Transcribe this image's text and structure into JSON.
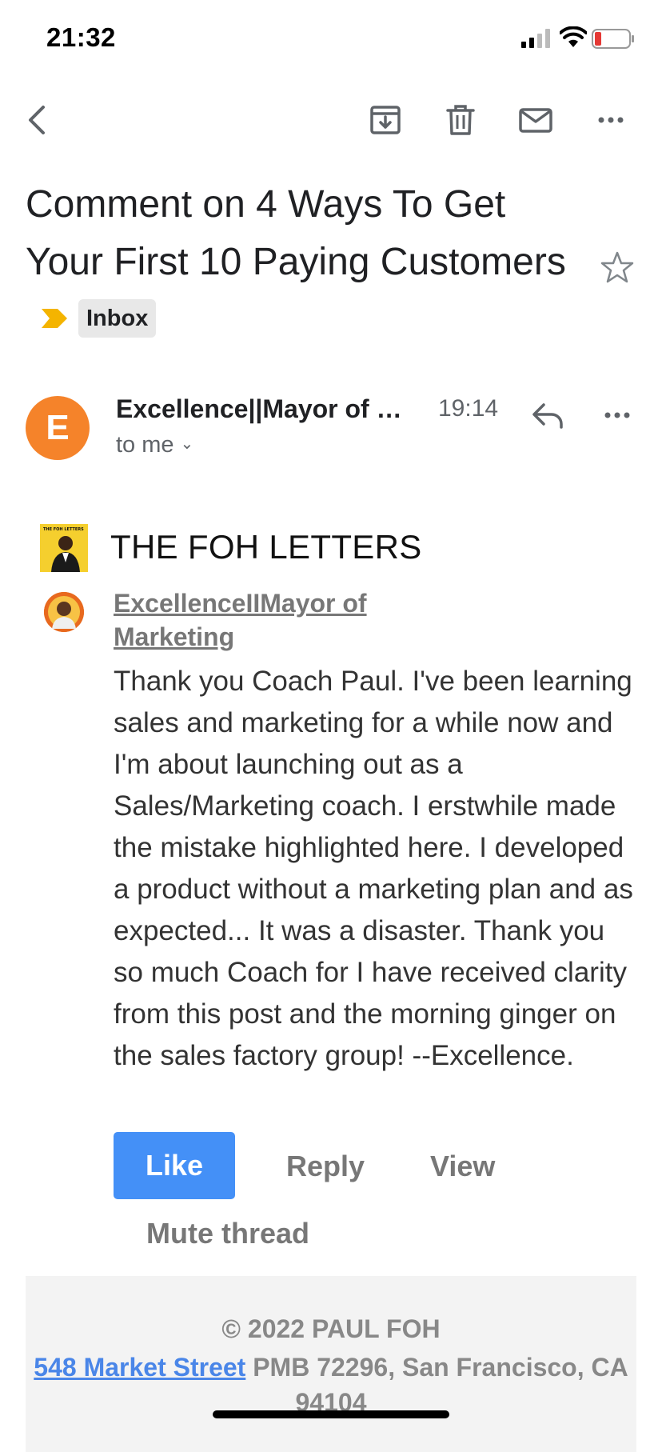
{
  "status_bar": {
    "time": "21:32"
  },
  "toolbar": {
    "back_icon": "chevron-left-icon",
    "archive_icon": "archive-icon",
    "delete_icon": "trash-icon",
    "mark_unread_icon": "mail-icon",
    "more_icon": "more-horizontal-icon"
  },
  "email": {
    "subject": "Comment on 4 Ways To Get Your First 10 Paying Customers",
    "label": "Inbox",
    "importance_color": "#f4b400",
    "sender": {
      "initial": "E",
      "name": "Excellence||Mayor of Marketing",
      "time": "19:14",
      "to": "to me",
      "avatar_color": "#f5832a"
    }
  },
  "body": {
    "brand_title": "THE FOH LETTERS",
    "brand_logo_text": "THE FOH LETTERS",
    "commenter_name": "ExcellenceIIMayor of Marketing",
    "comment": "Thank you Coach Paul. I've been learning sales and marketing for a while now and I'm about launching out as a Sales/Marketing coach. I erstwhile made the mistake highlighted here. I developed a product without a marketing plan and as expected... It was a disaster. Thank you so much Coach for I have received clarity from this post and the morning ginger on the sales factory group! --Excellence.",
    "actions": {
      "like": "Like",
      "reply": "Reply",
      "view": "View",
      "mute": "Mute thread"
    },
    "like_color": "#4490f7"
  },
  "footer": {
    "copyright": "© 2022 PAUL FOH",
    "street": "548 Market Street",
    "address_rest": " PMB 72296, San Francisco, CA 94104"
  }
}
